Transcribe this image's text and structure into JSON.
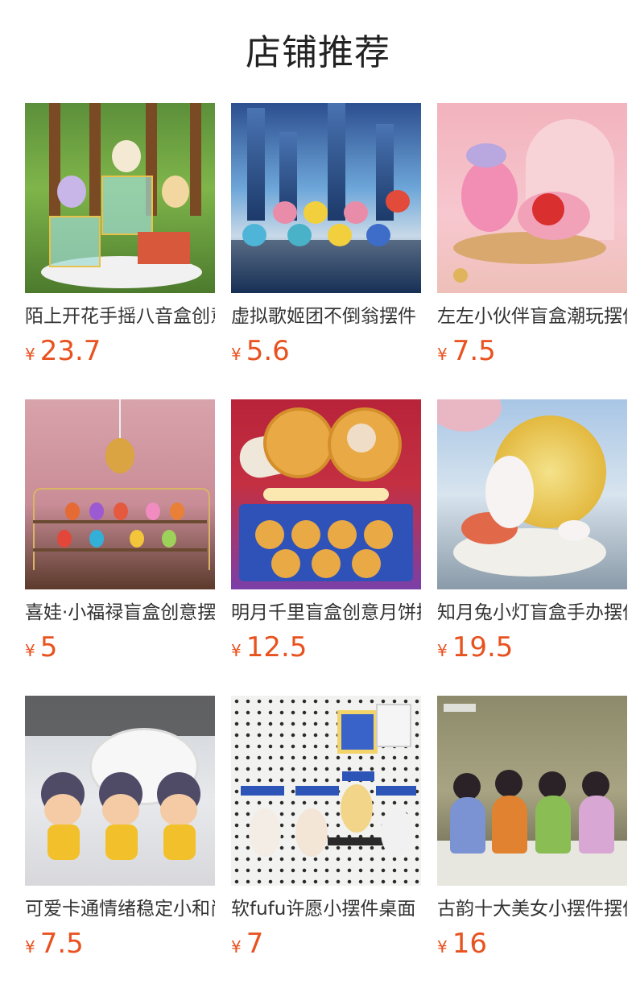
{
  "page": {
    "title": "店铺推荐"
  },
  "currency_symbol": "¥",
  "colors": {
    "price": "#e8521f",
    "text": "#333333",
    "title": "#222222"
  },
  "products": [
    {
      "name": "陌上开花手摇八音盒创意",
      "price": "23.7",
      "image": "forest-music-box-figures"
    },
    {
      "name": "虚拟歌姬团不倒翁摆件",
      "price": "5.6",
      "image": "tumbler-figures-city"
    },
    {
      "name": "左左小伙伴盲盒潮玩摆件",
      "price": "7.5",
      "image": "pink-figures"
    },
    {
      "name": "喜娃·小福禄盲盒创意摆件",
      "price": "5",
      "image": "gourd-figures-shelf"
    },
    {
      "name": "明月千里盲盒创意月饼摆件",
      "price": "12.5",
      "image": "mooncake-figures"
    },
    {
      "name": "知月兔小灯盲盒手办摆件",
      "price": "19.5",
      "image": "moon-bunny-lamp"
    },
    {
      "name": "可爱卡通情绪稳定小和尚",
      "price": "7.5",
      "image": "cute-monk-figures"
    },
    {
      "name": "软fufu许愿小摆件桌面",
      "price": "7",
      "image": "pegboard-figures"
    },
    {
      "name": "古韵十大美女小摆件摆件",
      "price": "16",
      "image": "ancient-beauty-figures"
    }
  ]
}
